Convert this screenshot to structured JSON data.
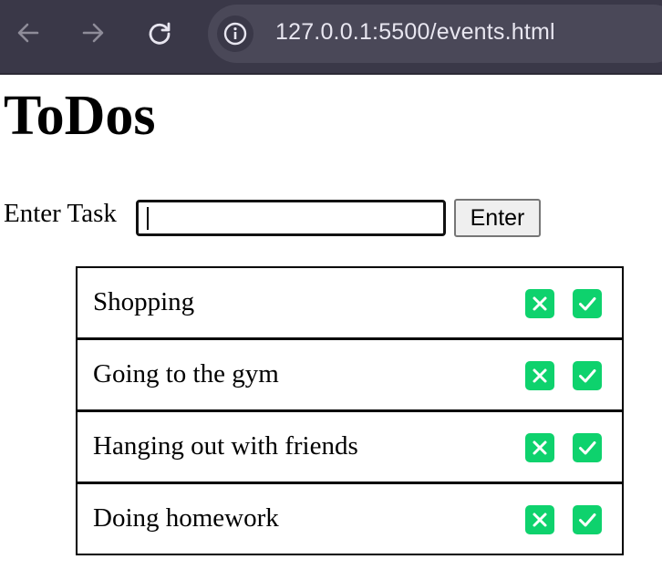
{
  "browser": {
    "url": "127.0.0.1:5500/events.html"
  },
  "page": {
    "title": "ToDos",
    "task_label": "Enter Task",
    "task_input_value": "",
    "enter_button_label": "Enter"
  },
  "todos": [
    {
      "label": "Shopping"
    },
    {
      "label": "Going to the gym"
    },
    {
      "label": "Hanging out with friends"
    },
    {
      "label": "Doing homework"
    }
  ],
  "icons": {
    "back": "arrow-left-icon",
    "forward": "arrow-right-icon",
    "reload": "reload-icon",
    "site_info": "info-icon",
    "delete": "close-icon",
    "done": "check-icon"
  },
  "colors": {
    "browser_bar": "#3a3848",
    "action_green": "#0ed26d"
  }
}
